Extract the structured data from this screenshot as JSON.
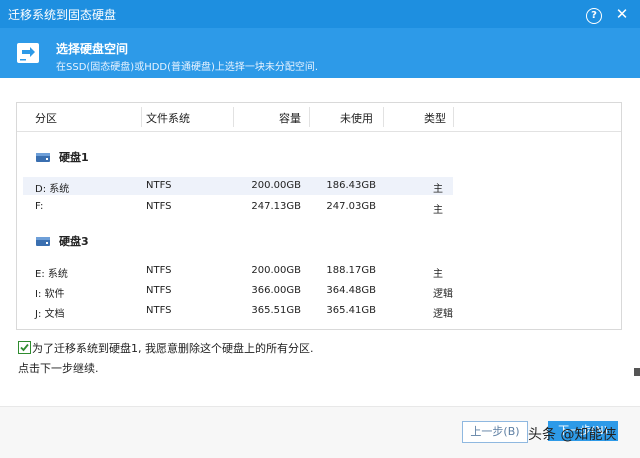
{
  "window": {
    "title": "迁移系统到固态硬盘",
    "help_label": "?",
    "close_label": "✕"
  },
  "header": {
    "title": "选择硬盘空间",
    "subtitle": "在SSD(固态硬盘)或HDD(普通硬盘)上选择一块未分配空间.",
    "icon": "ssd-migrate-icon"
  },
  "table": {
    "columns": [
      "分区",
      "文件系统",
      "容量",
      "未使用",
      "类型"
    ],
    "disks": [
      {
        "name": "硬盘1",
        "icon": "hard-disk-icon",
        "rows": [
          {
            "partition": "D:  系统",
            "fs": "NTFS",
            "capacity": "200.00GB",
            "unused": "186.43GB",
            "type": "主"
          },
          {
            "partition": "F:",
            "fs": "NTFS",
            "capacity": "247.13GB",
            "unused": "247.03GB",
            "type": "主"
          }
        ]
      },
      {
        "name": "硬盘3",
        "icon": "hard-disk-icon",
        "rows": [
          {
            "partition": "E:  系统",
            "fs": "NTFS",
            "capacity": "200.00GB",
            "unused": "188.17GB",
            "type": "主"
          },
          {
            "partition": "I:  软件",
            "fs": "NTFS",
            "capacity": "366.00GB",
            "unused": "364.48GB",
            "type": "逻辑"
          },
          {
            "partition": "J:  文档",
            "fs": "NTFS",
            "capacity": "365.51GB",
            "unused": "365.41GB",
            "type": "逻辑"
          }
        ]
      }
    ]
  },
  "consent": {
    "checked": true,
    "label": "为了迁移系统到硬盘1, 我愿意删除这个硬盘上的所有分区."
  },
  "instruction": "点击下一步继续.",
  "footer": {
    "prev_label": "上一步(B)",
    "next_label": "下一步(N)"
  },
  "watermark": "头条 @知能侠",
  "colors": {
    "titlebar": "#1e8fe0",
    "header": "#2d9ae8",
    "accent": "#2d9ae8",
    "selected_row": "#eef2fa"
  }
}
